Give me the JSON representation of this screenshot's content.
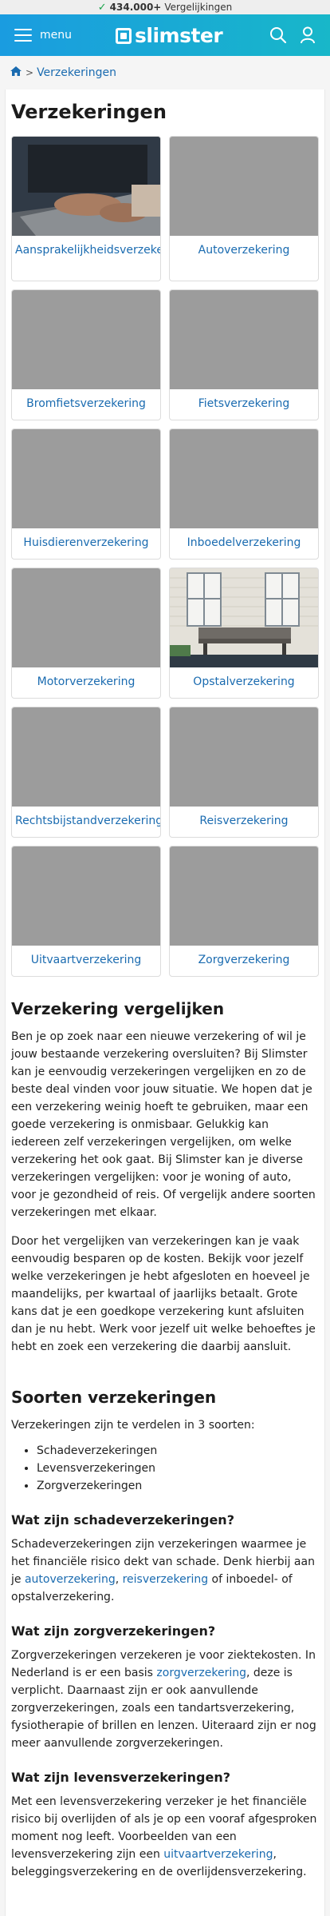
{
  "topbar": {
    "count": "434.000+",
    "label": "Vergelijkingen"
  },
  "header": {
    "menu_label": "menu",
    "logo_text": "slimster",
    "icons": [
      "search-icon",
      "user-icon"
    ]
  },
  "breadcrumb": {
    "home_icon": "home-icon",
    "current": "Verzekeringen"
  },
  "page": {
    "title": "Verzekeringen"
  },
  "cards": [
    {
      "label": "Aansprakelijkheidsverzekering",
      "image": "laptop-photo"
    },
    {
      "label": "Autoverzekering",
      "image": "placeholder"
    },
    {
      "label": "Bromfietsverzekering",
      "image": "placeholder"
    },
    {
      "label": "Fietsverzekering",
      "image": "placeholder"
    },
    {
      "label": "Huisdierenverzekering",
      "image": "placeholder"
    },
    {
      "label": "Inboedelverzekering",
      "image": "placeholder"
    },
    {
      "label": "Motorverzekering",
      "image": "placeholder"
    },
    {
      "label": "Opstalverzekering",
      "image": "house-photo"
    },
    {
      "label": "Rechtsbijstandverzekering",
      "image": "placeholder"
    },
    {
      "label": "Reisverzekering",
      "image": "placeholder"
    },
    {
      "label": "Uitvaartverzekering",
      "image": "placeholder"
    },
    {
      "label": "Zorgverzekering",
      "image": "placeholder"
    }
  ],
  "section1": {
    "heading": "Verzekering vergelijken",
    "p1": "Ben je op zoek naar een nieuwe verzekering of wil je jouw bestaande verzekering oversluiten? Bij Slimster kan je eenvoudig verzekeringen vergelijken en zo de beste deal vinden voor jouw situatie. We hopen dat je een verzekering weinig hoeft te gebruiken, maar een goede verzekering is onmisbaar. Gelukkig kan iedereen zelf verzekeringen vergelijken, om welke verzekering het ook gaat. Bij Slimster kan je diverse verzekeringen vergelijken: voor je woning of auto, voor je gezondheid of reis. Of vergelijk andere soorten verzekeringen met elkaar.",
    "p2": "Door het vergelijken van verzekeringen kan je vaak eenvoudig besparen op de kosten. Bekijk voor jezelf welke verzekeringen je hebt afgesloten en hoeveel je maandelijks, per kwartaal of jaarlijks betaalt. Grote kans dat je een goedkope verzekering kunt afsluiten dan je nu hebt. Werk voor jezelf uit welke behoeftes je hebt en zoek een verzekering die daarbij aansluit."
  },
  "section2": {
    "heading": "Soorten verzekeringen",
    "intro": "Verzekeringen zijn te verdelen in 3 soorten:",
    "types": [
      "Schadeverzekeringen",
      "Levensverzekeringen",
      "Zorgverzekeringen"
    ],
    "schade": {
      "heading": "Wat zijn schadeverzekeringen?",
      "text_a": "Schadeverzekeringen zijn verzekeringen waarmee je het financiële risico dekt van schade. Denk hierbij aan je ",
      "link1": "autoverzekering",
      "text_b": ", ",
      "link2": "reisverzekering",
      "text_c": " of inboedel- of opstalverzekering."
    },
    "zorg": {
      "heading": "Wat zijn zorgverzekeringen?",
      "text_a": "Zorgverzekeringen verzekeren je voor ziektekosten. In Nederland is er een basis ",
      "link1": "zorgverzekering",
      "text_b": ", deze is verplicht. Daarnaast zijn er ook aanvullende zorgverzekeringen, zoals een tandartsverzekering, fysiotherapie of brillen en lenzen. Uiteraard zijn er nog meer aanvullende zorgverzekeringen."
    },
    "leven": {
      "heading": "Wat zijn levensverzekeringen?",
      "text_a": "Met een levensverzekering verzeker je het financiële risico bij overlijden of als je op een vooraf afgesproken moment nog leeft. Voorbeelden van een levensverzekering zijn een ",
      "link1": "uitvaartverzekering",
      "text_b": ", beleggingsverzekering en de overlijdensverzekering."
    }
  }
}
